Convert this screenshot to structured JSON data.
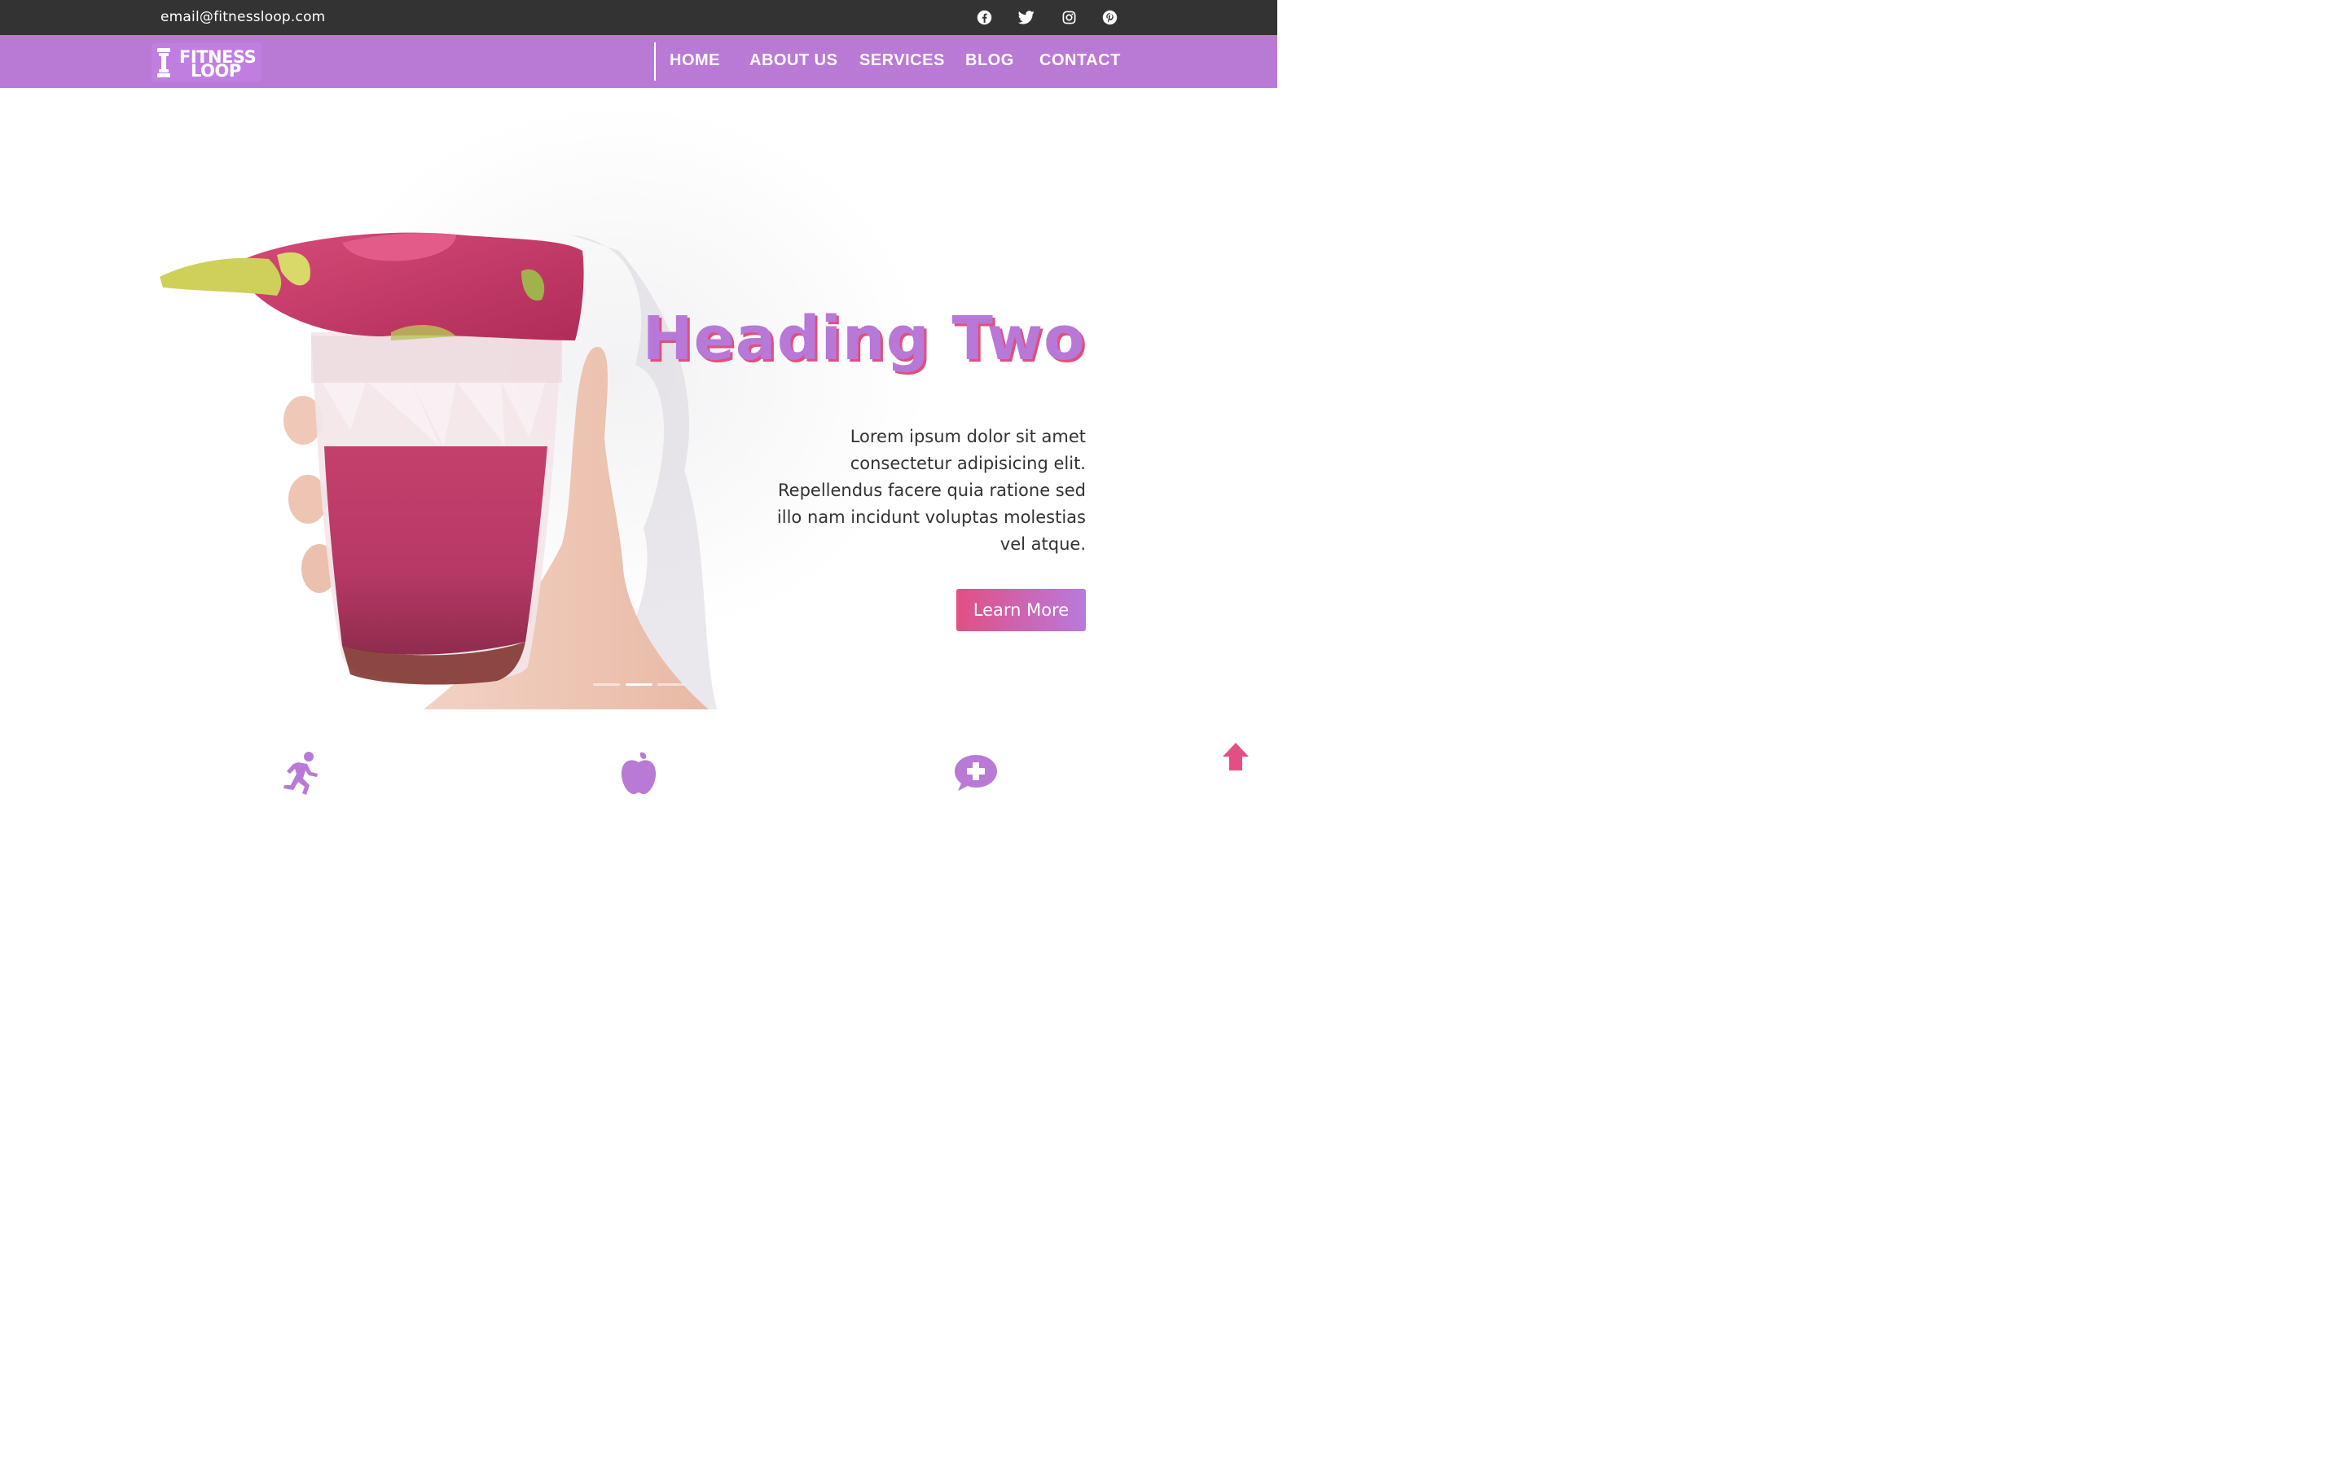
{
  "topbar": {
    "email": "email@fitnessloop.com",
    "social_icons": [
      "facebook-icon",
      "twitter-icon",
      "instagram-icon",
      "pinterest-icon"
    ]
  },
  "brand": {
    "line1": "FITNESS",
    "line2": "LOOP",
    "color": "#b97ad6"
  },
  "nav": {
    "items": [
      {
        "label": "HOME"
      },
      {
        "label": "ABOUT US"
      },
      {
        "label": "SERVICES"
      },
      {
        "label": "BLOG"
      },
      {
        "label": "CONTACT"
      }
    ]
  },
  "hero": {
    "heading": "Heading Two",
    "body": "Lorem ipsum dolor sit amet consectetur adipisicing elit. Repellendus facere quia ratione sed illo nam incidunt voluptas molestias vel atque.",
    "button": "Learn More",
    "slides": 3,
    "active_slide": 2,
    "heading_color": "#b878d8",
    "accent_color": "#e24f84"
  },
  "features": {
    "icons": [
      "running-icon",
      "apple-icon",
      "medical-chat-icon"
    ]
  },
  "scroll_top": {
    "icon": "arrow-up-icon"
  }
}
